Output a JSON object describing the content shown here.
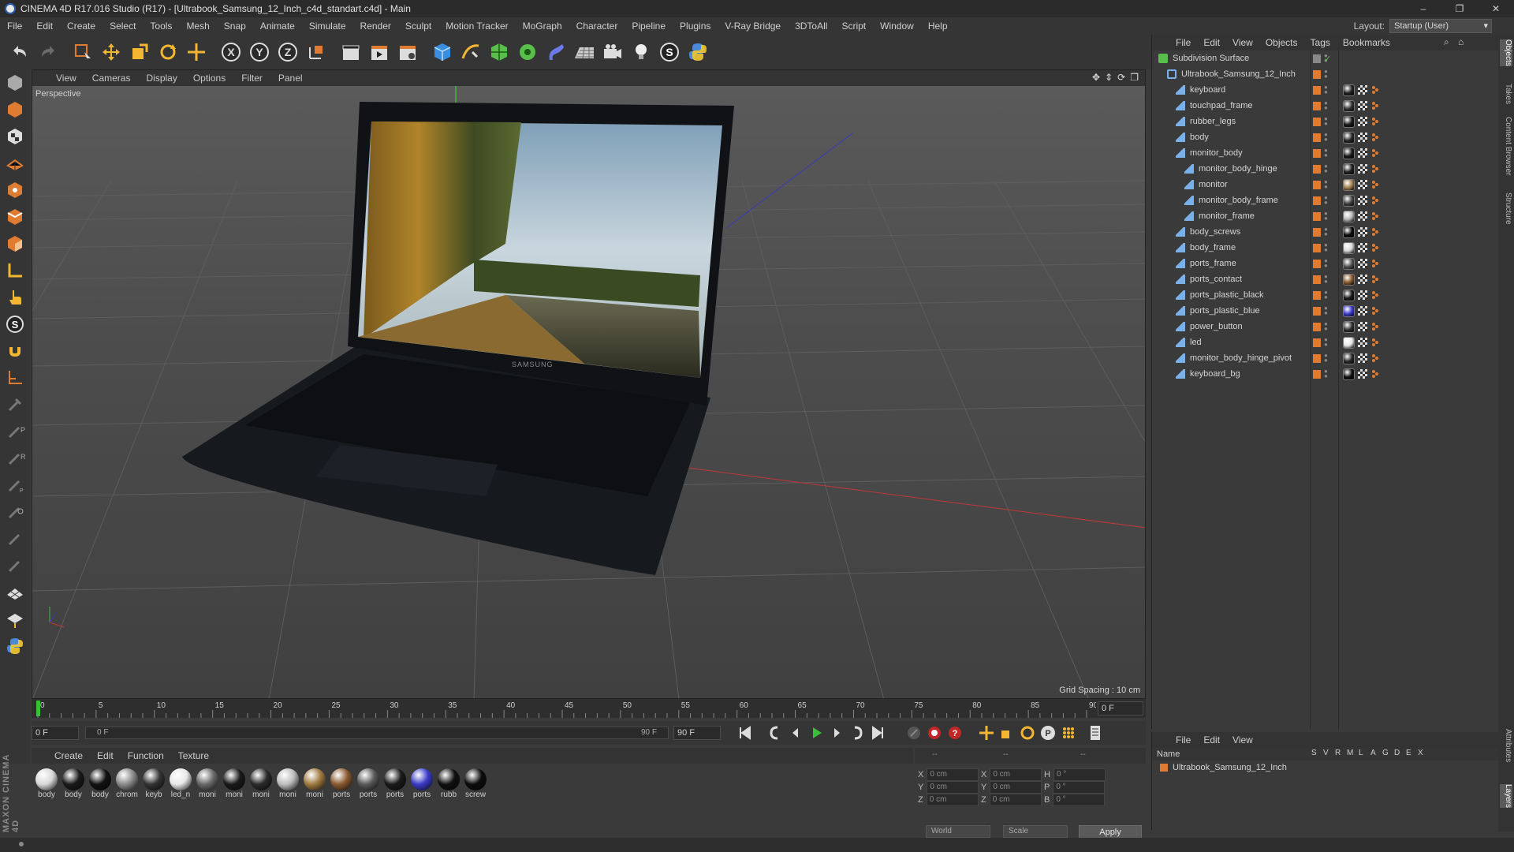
{
  "window": {
    "title": "CINEMA 4D R17.016 Studio (R17) - [Ultrabook_Samsung_12_Inch_c4d_standart.c4d] - Main",
    "buttons": [
      "–",
      "❐",
      "✕"
    ]
  },
  "menubar": {
    "items": [
      "File",
      "Edit",
      "Create",
      "Select",
      "Tools",
      "Mesh",
      "Snap",
      "Animate",
      "Simulate",
      "Render",
      "Sculpt",
      "Motion Tracker",
      "MoGraph",
      "Character",
      "Pipeline",
      "Plugins",
      "V-Ray Bridge",
      "3DToAll",
      "Script",
      "Window",
      "Help"
    ],
    "layout_label": "Layout:",
    "layout_value": "Startup (User)"
  },
  "viewport": {
    "menu": [
      "View",
      "Cameras",
      "Display",
      "Options",
      "Filter",
      "Panel"
    ],
    "label": "Perspective",
    "grid_spacing": "Grid Spacing : 10 cm",
    "screen_brand": "SAMSUNG"
  },
  "timeline": {
    "ticks": [
      "0",
      "5",
      "10",
      "15",
      "20",
      "25",
      "30",
      "35",
      "40",
      "45",
      "50",
      "55",
      "60",
      "65",
      "70",
      "75",
      "80",
      "85",
      "90"
    ],
    "current_frame": "0 F",
    "start_field": "0 F",
    "range_start": "0 F",
    "range_end": "90 F",
    "end_field": "90 F"
  },
  "materials": {
    "menu": [
      "Create",
      "Edit",
      "Function",
      "Texture"
    ],
    "items": [
      {
        "name": "body",
        "color": "#d8d8d8"
      },
      {
        "name": "body",
        "color": "#1a1a1a"
      },
      {
        "name": "body",
        "color": "#111111"
      },
      {
        "name": "chrom",
        "color": "#8a8a8a"
      },
      {
        "name": "keyb",
        "color": "#333333"
      },
      {
        "name": "led_n",
        "color": "#e8e8e8"
      },
      {
        "name": "moni",
        "color": "#6a6a6a"
      },
      {
        "name": "moni",
        "color": "#1a1a1a"
      },
      {
        "name": "moni",
        "color": "#2a2a2a"
      },
      {
        "name": "moni",
        "color": "#bdbdbd"
      },
      {
        "name": "moni",
        "color": "#a07a40"
      },
      {
        "name": "ports",
        "color": "#8a5a30"
      },
      {
        "name": "ports",
        "color": "#5a5a5a"
      },
      {
        "name": "ports",
        "color": "#1a1a1a"
      },
      {
        "name": "ports",
        "color": "#3b3bc8"
      },
      {
        "name": "rubb",
        "color": "#101010"
      },
      {
        "name": "screw",
        "color": "#0c0c0c"
      }
    ]
  },
  "coords": {
    "headers": [
      "--",
      "--",
      "--"
    ],
    "rows": [
      {
        "a": "X",
        "a_val": "0 cm",
        "b": "X",
        "b_val": "0 cm",
        "c": "H",
        "c_val": "0 °"
      },
      {
        "a": "Y",
        "a_val": "0 cm",
        "b": "Y",
        "b_val": "0 cm",
        "c": "P",
        "c_val": "0 °"
      },
      {
        "a": "Z",
        "a_val": "0 cm",
        "b": "Z",
        "b_val": "0 cm",
        "c": "B",
        "c_val": "0 °"
      }
    ],
    "mode": "World",
    "type": "Scale",
    "apply": "Apply"
  },
  "objects": {
    "menu": [
      "File",
      "Edit",
      "View",
      "Objects",
      "Tags",
      "Bookmarks"
    ],
    "items": [
      {
        "name": "Subdivision Surface",
        "indent": 0,
        "kind": "subdiv"
      },
      {
        "name": "Ultrabook_Samsung_12_Inch",
        "indent": 1,
        "kind": "null"
      },
      {
        "name": "keyboard",
        "indent": 2,
        "kind": "poly",
        "tag": "#222222"
      },
      {
        "name": "touchpad_frame",
        "indent": 2,
        "kind": "poly",
        "tag": "#333333"
      },
      {
        "name": "rubber_legs",
        "indent": 2,
        "kind": "poly",
        "tag": "#1a1a1a"
      },
      {
        "name": "body",
        "indent": 2,
        "kind": "poly",
        "tag": "#2a2a2a"
      },
      {
        "name": "monitor_body",
        "indent": 2,
        "kind": "poly",
        "tag": "#1a1a1a"
      },
      {
        "name": "monitor_body_hinge",
        "indent": 3,
        "kind": "poly",
        "tag": "#222222"
      },
      {
        "name": "monitor",
        "indent": 3,
        "kind": "poly",
        "tag": "#a08050"
      },
      {
        "name": "monitor_body_frame",
        "indent": 3,
        "kind": "poly",
        "tag": "#444444"
      },
      {
        "name": "monitor_frame",
        "indent": 3,
        "kind": "poly",
        "tag": "#bbbbbb"
      },
      {
        "name": "body_screws",
        "indent": 2,
        "kind": "poly",
        "tag": "#0c0c0c"
      },
      {
        "name": "body_frame",
        "indent": 2,
        "kind": "poly",
        "tag": "#d8d8d8"
      },
      {
        "name": "ports_frame",
        "indent": 2,
        "kind": "poly",
        "tag": "#555555"
      },
      {
        "name": "ports_contact",
        "indent": 2,
        "kind": "poly",
        "tag": "#8a5a30"
      },
      {
        "name": "ports_plastic_black",
        "indent": 2,
        "kind": "poly",
        "tag": "#1a1a1a"
      },
      {
        "name": "ports_plastic_blue",
        "indent": 2,
        "kind": "poly",
        "tag": "#3b3bc8"
      },
      {
        "name": "power_button",
        "indent": 2,
        "kind": "poly",
        "tag": "#333333"
      },
      {
        "name": "led",
        "indent": 2,
        "kind": "poly",
        "tag": "#e8e8e8"
      },
      {
        "name": "monitor_body_hinge_pivot",
        "indent": 2,
        "kind": "poly",
        "tag": "#2a2a2a"
      },
      {
        "name": "keyboard_bg",
        "indent": 2,
        "kind": "poly",
        "tag": "#111111"
      }
    ]
  },
  "layers": {
    "menu": [
      "File",
      "Edit",
      "View"
    ],
    "header_name": "Name",
    "columns": [
      "S",
      "V",
      "R",
      "M",
      "L",
      "A",
      "G",
      "D",
      "E",
      "X"
    ],
    "items": [
      {
        "name": "Ultrabook_Samsung_12_Inch"
      }
    ]
  },
  "right_tabs": [
    "Objects",
    "Takes",
    "Content Browser",
    "Structure",
    "Attributes",
    "Layers"
  ],
  "brand": "MAXON CINEMA 4D",
  "colors": {
    "accent": "#e07b32",
    "bg": "#3a3a3a",
    "panel": "#353535"
  }
}
